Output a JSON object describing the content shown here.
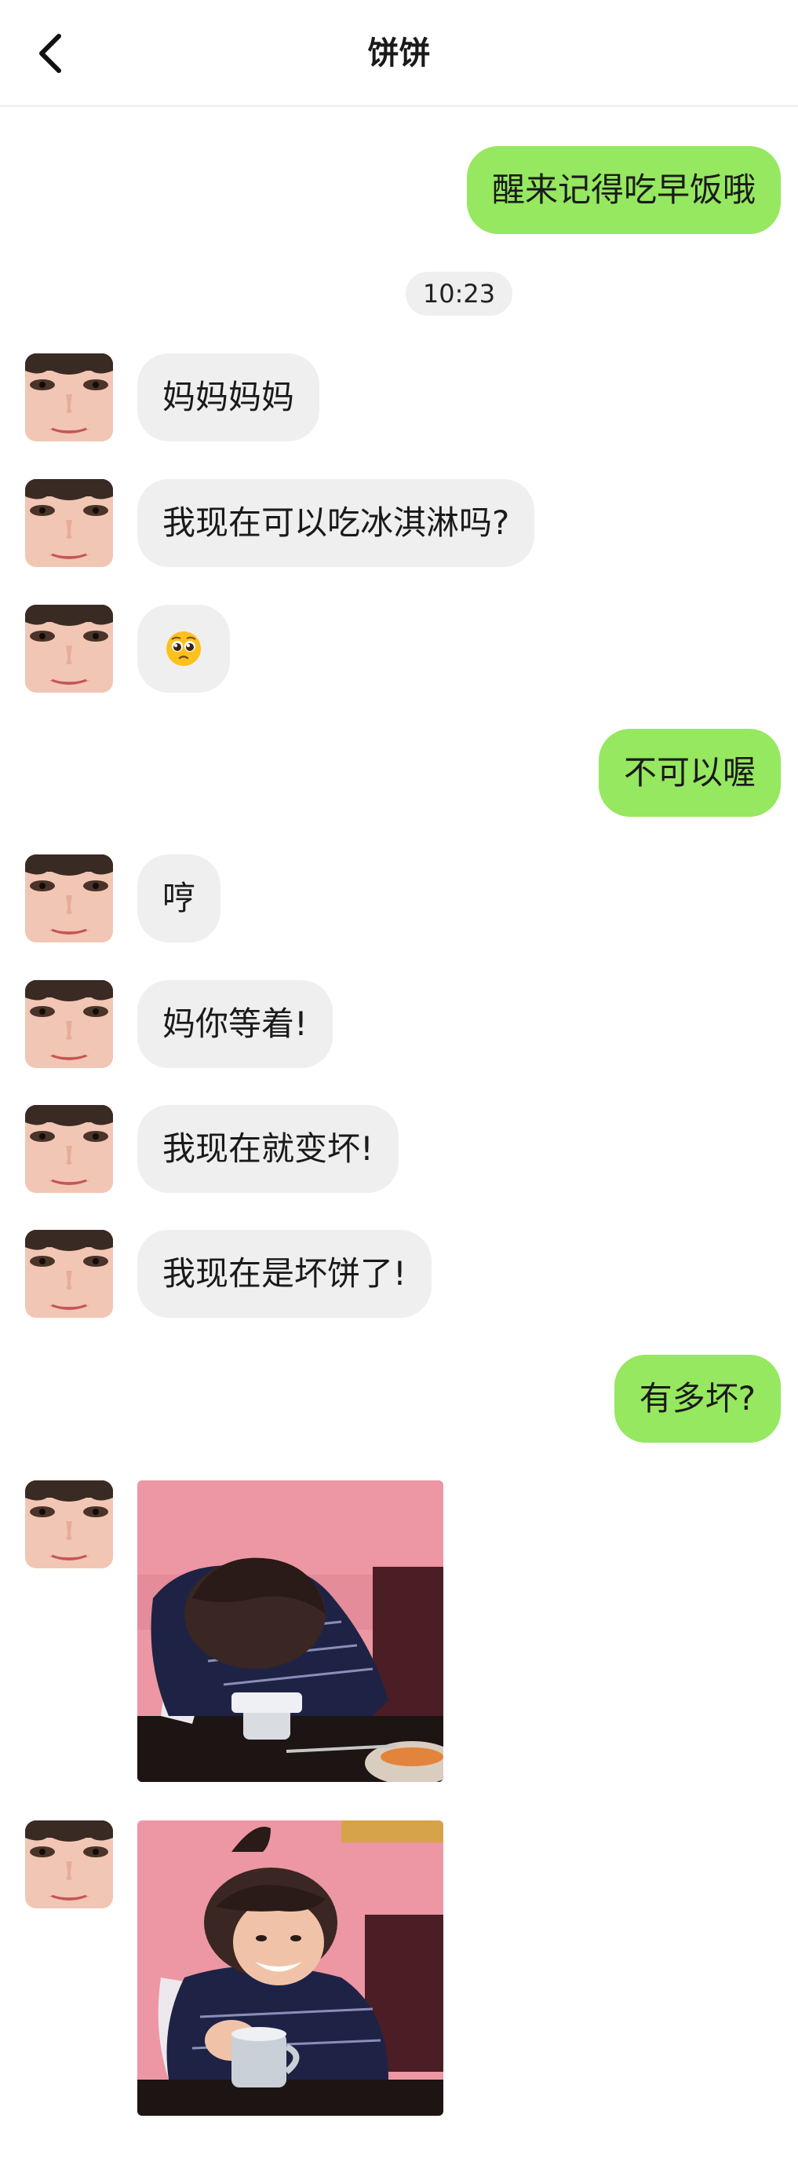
{
  "header": {
    "title": "饼饼"
  },
  "timestamp": "10:23",
  "messages": [
    {
      "side": "out",
      "text": "醒来记得吃早饭哦"
    },
    {
      "side": "in",
      "text": "妈妈妈妈"
    },
    {
      "side": "in",
      "text": "我现在可以吃冰淇淋吗?"
    },
    {
      "side": "in",
      "emoji": "pleading-face-emoji"
    },
    {
      "side": "out",
      "text": "不可以喔"
    },
    {
      "side": "in",
      "text": "哼"
    },
    {
      "side": "in",
      "text": "妈你等着!"
    },
    {
      "side": "in",
      "text": "我现在就变坏!"
    },
    {
      "side": "in",
      "text": "我现在是坏饼了!"
    },
    {
      "side": "out",
      "text": "有多坏?"
    },
    {
      "side": "in",
      "image": "photo-boy-face-down-on-table"
    },
    {
      "side": "in",
      "image": "photo-boy-smiling-with-mug"
    }
  ],
  "colors": {
    "outgoing_bubble": "#95e85f",
    "incoming_bubble": "#efefef",
    "background": "#ffffff"
  },
  "icons": {
    "back": "chevron-left-icon"
  }
}
